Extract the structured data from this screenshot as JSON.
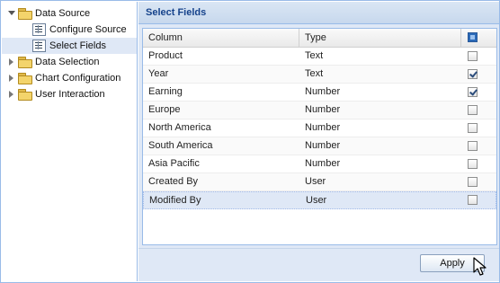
{
  "tree": {
    "items": [
      {
        "label": "Data Source",
        "icon": "folder-icon",
        "state": "expanded"
      },
      {
        "label": "Configure Source",
        "icon": "form-icon"
      },
      {
        "label": "Select Fields",
        "icon": "form-icon",
        "selected": true
      },
      {
        "label": "Data Selection",
        "icon": "folder-icon",
        "state": "collapsed"
      },
      {
        "label": "Chart Configuration",
        "icon": "folder-icon",
        "state": "collapsed"
      },
      {
        "label": "User Interaction",
        "icon": "folder-icon",
        "state": "collapsed"
      }
    ]
  },
  "panel": {
    "title": "Select Fields",
    "columns": [
      "Column",
      "Type"
    ],
    "rows": [
      {
        "column": "Product",
        "type": "Text",
        "checked": false
      },
      {
        "column": "Year",
        "type": "Text",
        "checked": true
      },
      {
        "column": "Earning",
        "type": "Number",
        "checked": true
      },
      {
        "column": "Europe",
        "type": "Number",
        "checked": false
      },
      {
        "column": "North America",
        "type": "Number",
        "checked": false
      },
      {
        "column": "South America",
        "type": "Number",
        "checked": false
      },
      {
        "column": "Asia Pacific",
        "type": "Number",
        "checked": false
      },
      {
        "column": "Created By",
        "type": "User",
        "checked": false
      },
      {
        "column": "Modified By",
        "type": "User",
        "checked": false,
        "selected": true
      }
    ],
    "apply_label": "Apply"
  },
  "colors": {
    "accent": "#15428b",
    "border": "#99bbe8",
    "selection": "#dfe8f6"
  }
}
